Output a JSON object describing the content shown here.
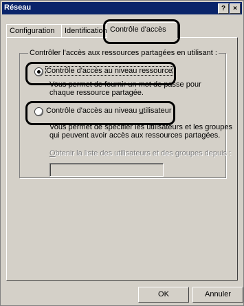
{
  "window": {
    "title": "Réseau",
    "help_button": "?",
    "close_button": "×"
  },
  "tabs": [
    {
      "label": "Configuration"
    },
    {
      "label": "Identification"
    },
    {
      "label": "Contrôle d'accès",
      "active": true
    }
  ],
  "group": {
    "legend": "Contrôler l'accès aux ressources partagées en utilisant :"
  },
  "options": {
    "share_level": {
      "label": "Contrôle d'accès au niveau ressource",
      "selected": true,
      "description_line1": "Vous permet de fournir un mot de passe pour",
      "description_line2": "chaque ressource partagée."
    },
    "user_level": {
      "label_before": "Contrôle d'accès au niveau ",
      "label_underlined": "u",
      "label_after": "tilisateur",
      "selected": false,
      "description_line1": "Vous permet de spécifier les utilisateurs et les groupes",
      "description_line2": "qui peuvent avoir accès aux ressources partagées."
    }
  },
  "obtain_list": {
    "label_underlined": "O",
    "label_rest": "btenir la liste des utilisateurs et des groupes depuis :",
    "value": ""
  },
  "buttons": {
    "ok": "OK",
    "cancel": "Annuler"
  }
}
